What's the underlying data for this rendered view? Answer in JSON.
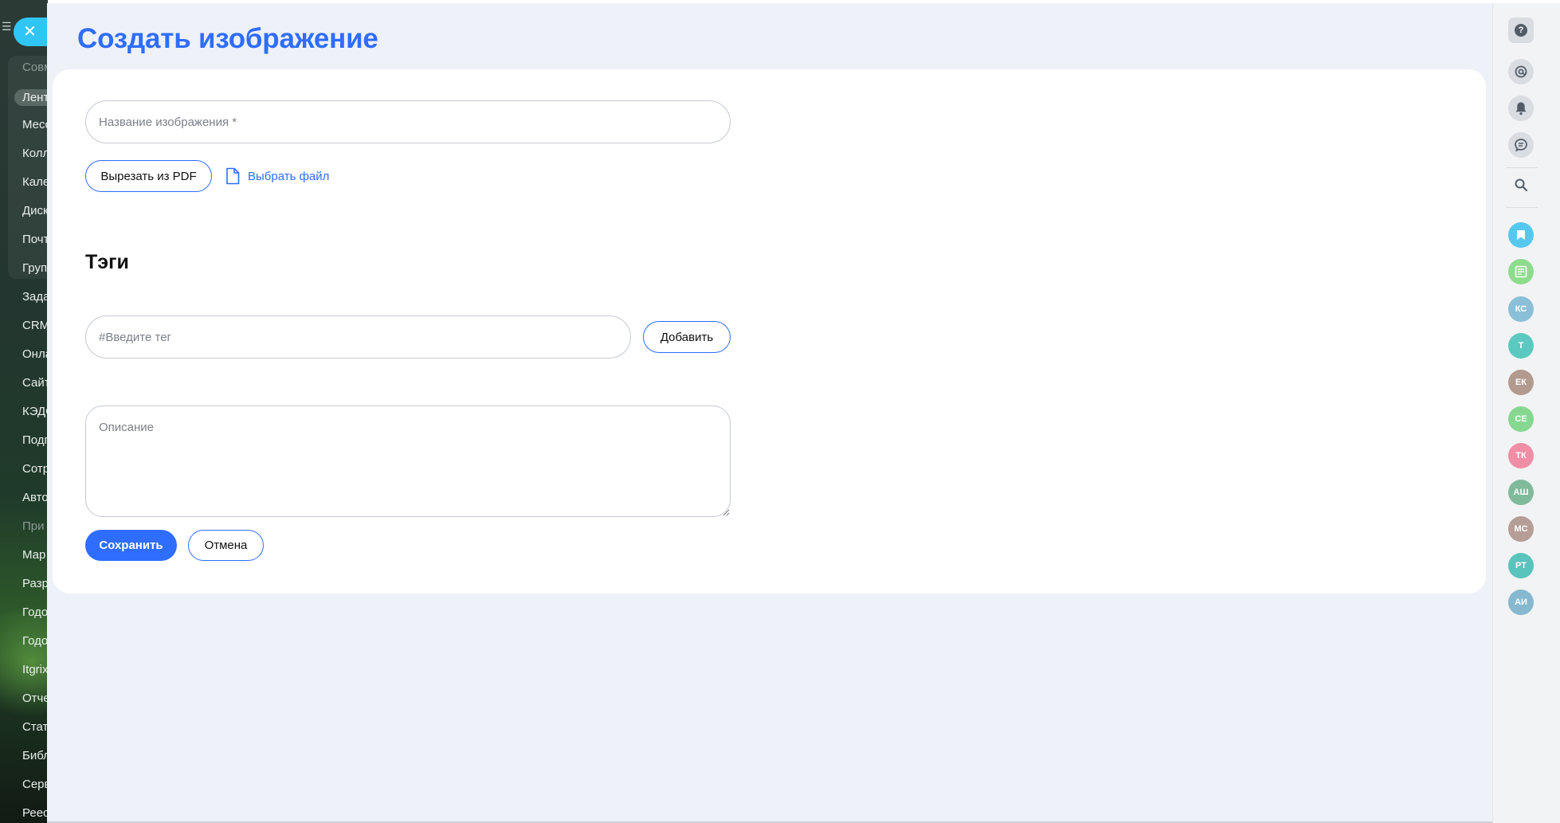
{
  "background_menu": {
    "items": [
      {
        "label": "Совм",
        "dim": true
      },
      {
        "label": "Лент",
        "active": true
      },
      {
        "label": "Месс"
      },
      {
        "label": "Колл"
      },
      {
        "label": "Кале"
      },
      {
        "label": "Диск"
      },
      {
        "label": "Почт"
      },
      {
        "label": "Груп"
      },
      {
        "label": "Зада"
      },
      {
        "label": "CRM"
      },
      {
        "label": "Онла"
      },
      {
        "label": "Сайт"
      },
      {
        "label": "КЭДС"
      },
      {
        "label": "Подп"
      },
      {
        "label": "Сотр"
      },
      {
        "label": "Авто"
      },
      {
        "label": "При",
        "dim": true
      },
      {
        "label": "Мар"
      },
      {
        "label": "Разр"
      },
      {
        "label": "Годо"
      },
      {
        "label": "Годо"
      },
      {
        "label": "Itgrix"
      },
      {
        "label": "Отче"
      },
      {
        "label": "Стат"
      },
      {
        "label": "Библ"
      },
      {
        "label": "Серв"
      },
      {
        "label": "Реес"
      }
    ]
  },
  "close_button": {
    "icon": "close-icon",
    "glyph": "✕"
  },
  "page": {
    "title": "Создать изображение"
  },
  "form": {
    "name_placeholder": "Название изображения *",
    "cut_pdf_label": "Вырезать из PDF",
    "choose_file_label": "Выбрать файл",
    "tags_title": "Тэги",
    "tag_placeholder": "#Введите тег",
    "add_label": "Добавить",
    "description_placeholder": "Описание",
    "save_label": "Сохранить",
    "cancel_label": "Отмена"
  },
  "right_sidebar": {
    "icons": [
      "help-icon",
      "at-sign-icon",
      "bell-icon",
      "chat-icon",
      "search-icon",
      "bookmark-icon",
      "news-icon"
    ],
    "help_glyph": "?",
    "avatars": [
      {
        "initials": "КС",
        "color": "#8bbfd8"
      },
      {
        "initials": "Т",
        "color": "#5cc9c0"
      },
      {
        "initials": "ЕК",
        "color": "#b39a8e"
      },
      {
        "initials": "СЕ",
        "color": "#86d890"
      },
      {
        "initials": "ТК",
        "color": "#ef8ea5"
      },
      {
        "initials": "АШ",
        "color": "#7fba9a"
      },
      {
        "initials": "МС",
        "color": "#b59e96"
      },
      {
        "initials": "РТ",
        "color": "#58c4bc"
      },
      {
        "initials": "АИ",
        "color": "#86b8d0"
      }
    ]
  },
  "colors": {
    "accent": "#2f6dff",
    "panel_bg": "#eef1f8",
    "close_button": "#2fc6f6"
  }
}
